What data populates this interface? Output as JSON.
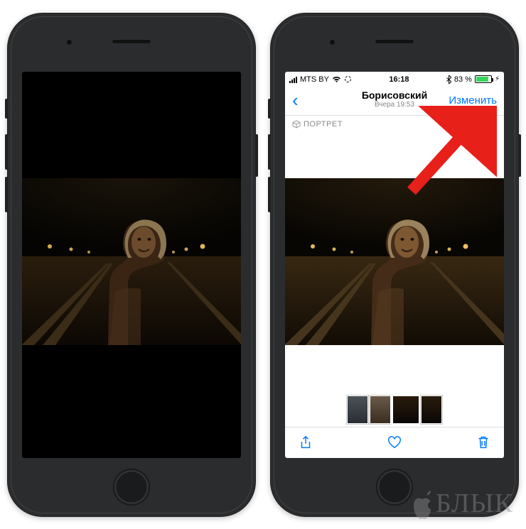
{
  "statusbar": {
    "carrier": "MTS BY",
    "time": "16:18",
    "battery_pct": "83 %"
  },
  "nav": {
    "title": "Борисовский",
    "subtitle": "Вчера 19:53",
    "edit_label": "Изменить"
  },
  "badge": {
    "portrait_label": "ПОРТРЕТ"
  },
  "watermark": {
    "text": "БЛЫК"
  }
}
